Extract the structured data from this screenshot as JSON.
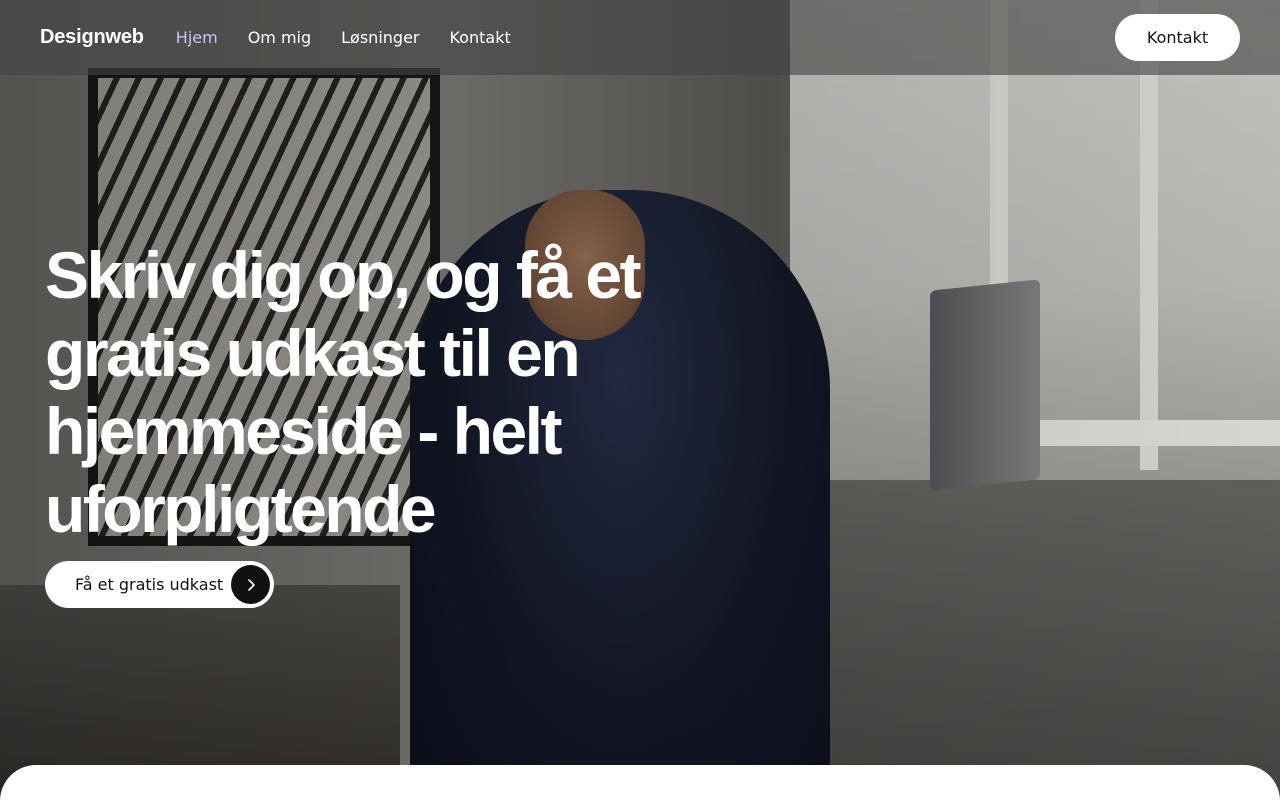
{
  "header": {
    "brand": "Designweb",
    "nav": [
      {
        "label": "Hjem",
        "active": true
      },
      {
        "label": "Om mig",
        "active": false
      },
      {
        "label": "Løsninger",
        "active": false
      },
      {
        "label": "Kontakt",
        "active": false
      }
    ],
    "contact_button": "Kontakt"
  },
  "hero": {
    "headline": "Skriv dig op, og få et gratis udkast til en hjemmeside - helt uforpligtende",
    "cta_label": "Få et gratis udkast",
    "cta_icon": "chevron-right-icon"
  },
  "colors": {
    "active_nav": "#c9c4ff",
    "button_bg": "#ffffff",
    "cta_circle": "#111111"
  }
}
